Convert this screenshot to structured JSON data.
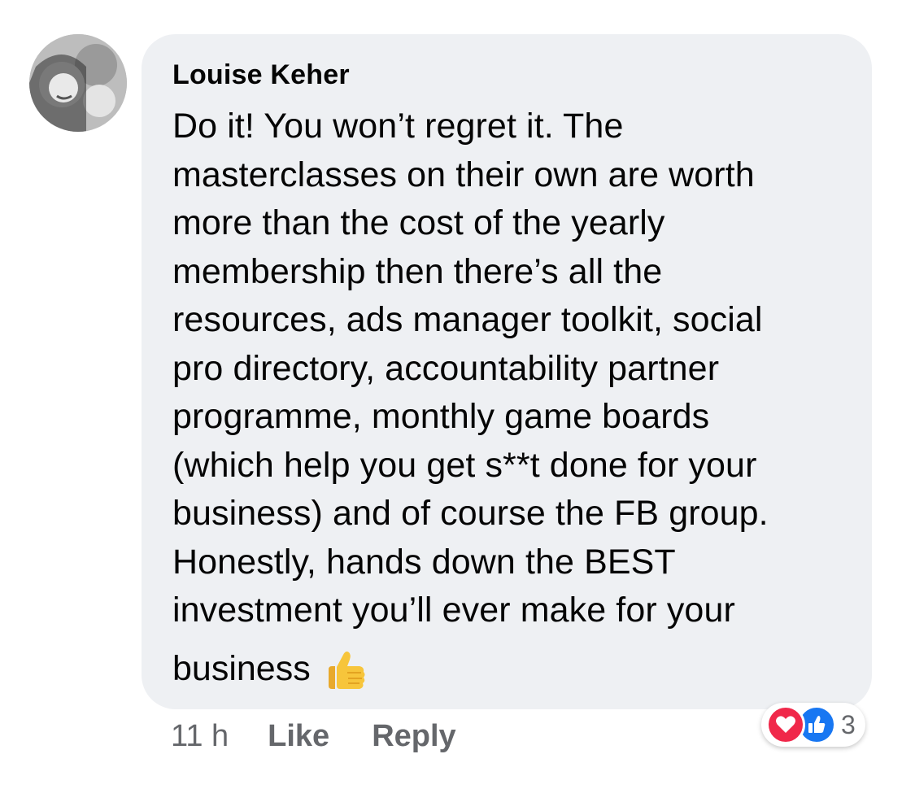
{
  "comment": {
    "author": "Louise Keher",
    "text": "Do it! You won’t regret it. The\nmasterclasses on their own are worth\nmore than the cost of the yearly\nmembership then there’s all the\nresources, ads manager toolkit, social\npro directory, accountability partner\nprogramme, monthly game boards\n(which help you get s**t done for your\nbusiness) and of course the FB group.\nHonestly, hands down the BEST\ninvestment you’ll ever make for your",
    "tail": "business",
    "tail_emoji": "thumbs-up-icon"
  },
  "actions": {
    "time": "11 h",
    "like_label": "Like",
    "reply_label": "Reply"
  },
  "reactions": {
    "icons": [
      "love-reaction-icon",
      "like-reaction-icon"
    ],
    "count": "3"
  },
  "colors": {
    "bubble_bg": "#eef0f3",
    "meta_text": "#65676b",
    "love": "#f0284a",
    "like": "#1877f2",
    "thumbs_emoji": "#f7c53b"
  }
}
